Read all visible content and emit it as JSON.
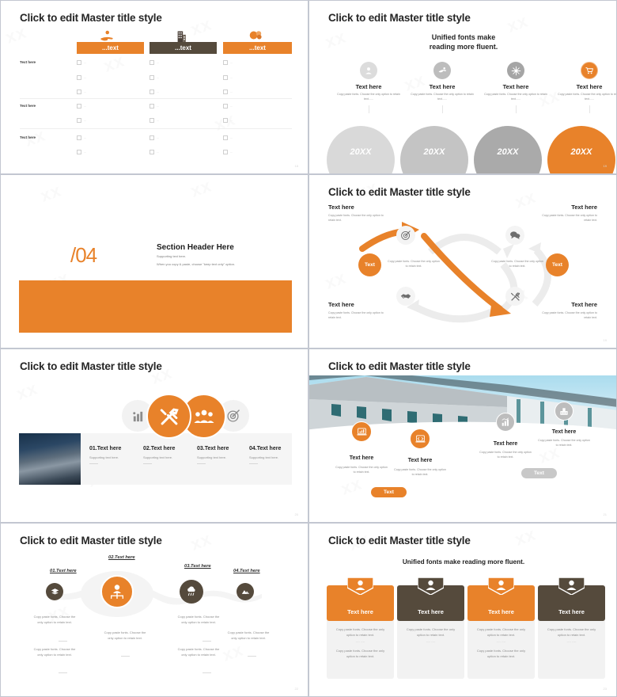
{
  "common": {
    "master_title": "Click to edit Master title style",
    "text_here": "Text here",
    "body_copy": "Copy paste fonts. Choose the only option to retain text.",
    "body_copy_ellipsis": "Copy paste fonts. Choose the only option to retain text......",
    "supporting": "Supporting text here.",
    "colors": {
      "orange": "#e8822a",
      "brown": "#554a3c",
      "gray": "#a8a8a8",
      "light_gray": "#d6d6d6",
      "sky": "#aadcee"
    }
  },
  "slides": [
    {
      "id": "slide-18-checklist-table",
      "page": "18",
      "title": "Click to edit Master title style",
      "columns": [
        {
          "label": "...text",
          "color": "#e8822a",
          "icon": "hand-coin-icon"
        },
        {
          "label": "...text",
          "color": "#554a3c",
          "icon": "building-icon"
        },
        {
          "label": "...text",
          "color": "#e8822a",
          "icon": "coins-icon"
        }
      ],
      "rows": [
        {
          "label": "Text here",
          "items": 3
        },
        {
          "label": "Text here",
          "items": 2
        },
        {
          "label": "Text here",
          "items": 2
        }
      ],
      "cell_text": "..."
    },
    {
      "id": "slide-19-timeline-arcs",
      "page": "19",
      "title": "Click to edit Master title style",
      "subtitle_line1": "Unified fonts make",
      "subtitle_line2": "reading more fluent.",
      "items": [
        {
          "heading": "Text here",
          "body": "Copy paste fonts. Choose the only option to retain text......",
          "icon": "person-icon",
          "icon_bg": "#dcdcdc",
          "year": "20XX",
          "arc_color": "#d9d9d9"
        },
        {
          "heading": "Text here",
          "body": "Copy paste fonts. Choose the only option to retain text......",
          "icon": "hand-icon",
          "icon_bg": "#bdbdbd",
          "year": "20XX",
          "arc_color": "#c4c4c4"
        },
        {
          "heading": "Text here",
          "body": "Copy paste fonts. Choose the only option to retain text......",
          "icon": "snowflake-icon",
          "icon_bg": "#a5a5a5",
          "year": "20XX",
          "arc_color": "#aaaaaa"
        },
        {
          "heading": "Text here",
          "body": "Copy paste fonts. Choose the only option to retain text......",
          "icon": "cart-icon",
          "icon_bg": "#e8822a",
          "year": "20XX",
          "arc_color": "#e8822a"
        }
      ]
    },
    {
      "id": "slide-section-header",
      "page": "",
      "number": "/04",
      "heading": "Section Header Here",
      "support1": "Supporting text here.",
      "support2": "When you copy & paste, choose \"keep text only\" option.",
      "band_color": "#e8822a"
    },
    {
      "id": "slide-19b-cycle-arrows",
      "page": "19",
      "title": "Click to edit Master title style",
      "corners": [
        {
          "heading": "Text here",
          "body": "Copy paste fonts. Choose the only option to retain text."
        },
        {
          "heading": "Text here",
          "body": "Copy paste fonts. Choose the only option to retain text."
        },
        {
          "heading": "Text here",
          "body": "Copy paste fonts. Choose the only option to retain text."
        },
        {
          "heading": "Text here",
          "body": "Copy paste fonts. Choose the only option to retain text."
        }
      ],
      "nodes": [
        {
          "icon": "target-icon"
        },
        {
          "icon": "speech-bubbles-icon"
        },
        {
          "icon": "handshake-icon"
        },
        {
          "icon": "tools-icon"
        }
      ],
      "bubbles": [
        {
          "label": "Text"
        },
        {
          "label": "Text"
        }
      ],
      "mid_bodies": [
        "Copy paste fonts. Choose the only option to retain text.",
        "Copy paste fonts. Choose the only option to retain text."
      ]
    },
    {
      "id": "slide-20-four-items",
      "page": "20",
      "title": "Click to edit Master title style",
      "icons": [
        {
          "icon": "chart-bars-icon",
          "bg": "#f2f2f2",
          "fg": "#8c8c8c",
          "size": "small"
        },
        {
          "icon": "tools-icon",
          "bg": "#e8822a",
          "fg": "#ffffff",
          "size": "large"
        },
        {
          "icon": "people-group-icon",
          "bg": "#e8822a",
          "fg": "#ffffff",
          "size": "large"
        },
        {
          "icon": "target-icon",
          "bg": "#f2f2f2",
          "fg": "#8c8c8c",
          "size": "small"
        }
      ],
      "cells": [
        {
          "heading": "01.Text here",
          "body": "Supporting text here."
        },
        {
          "heading": "02.Text here",
          "body": "Supporting text here."
        },
        {
          "heading": "03.Text here",
          "body": "Supporting text here."
        },
        {
          "heading": "04.Text here",
          "body": "Supporting text here."
        }
      ],
      "photo_alt": "mountain-photo"
    },
    {
      "id": "slide-21-building-photo",
      "page": "21",
      "title": "Click to edit Master title style",
      "photo_alt": "building-photo",
      "items": [
        {
          "heading": "Text here",
          "body": "Copy paste fonts. Choose the only option to retain text.",
          "icon": "laptop-chart-icon",
          "bg": "#e8822a"
        },
        {
          "heading": "Text here",
          "body": "Copy paste fonts. Choose the only option to retain text.",
          "icon": "laptop-code-icon",
          "bg": "#e8822a"
        },
        {
          "heading": "Text here",
          "body": "Copy paste fonts. Choose the only option to retain text.",
          "icon": "bar-chart-icon",
          "bg": "#bdbdbd"
        },
        {
          "heading": "Text here",
          "body": "Copy paste fonts. Choose the only option to retain text.",
          "icon": "factory-icon",
          "bg": "#bdbdbd"
        }
      ],
      "pills": [
        {
          "label": "Text",
          "bg": "#e8822a"
        },
        {
          "label": "Text",
          "bg": "#c8c8c8"
        }
      ]
    },
    {
      "id": "slide-22-chain",
      "page": "22",
      "title": "Click to edit Master title style",
      "nodes": [
        {
          "heading": "01.Text here",
          "icon": "layers-icon",
          "bg": "#554a3c",
          "size": 22,
          "bodies": [
            "Copy paste fonts. Choose the only option to retain text.",
            "Copy paste fonts. Choose the only option to retain text."
          ]
        },
        {
          "heading": "02.Text here",
          "icon": "person-network-icon",
          "bg": "#e8822a",
          "size": 42,
          "bodies": [
            "Copy paste fonts. Choose the only option to retain text."
          ]
        },
        {
          "heading": "03.Text here",
          "icon": "cloud-rain-icon",
          "bg": "#554a3c",
          "size": 30,
          "bodies": [
            "Copy paste fonts. Choose the only option to retain text.",
            "Copy paste fonts. Choose the only option to retain text."
          ]
        },
        {
          "heading": "04.Text here",
          "icon": "mountain-icon",
          "bg": "#554a3c",
          "size": 22,
          "bodies": [
            "Copy paste fonts. Choose the only option to retain text."
          ]
        }
      ]
    },
    {
      "id": "slide-23-cards",
      "page": "23",
      "title": "Click to edit Master title style",
      "subtitle": "Unified fonts make reading more fluent.",
      "cards": [
        {
          "heading": "Text here",
          "color": "#e8822a",
          "icon": "person-icon",
          "bodies": [
            "Copy paste fonts. Choose the only option to retain text.",
            "Copy paste fonts. Choose the only option to retain text."
          ],
          "divider": "---- ----"
        },
        {
          "heading": "Text here",
          "color": "#554a3c",
          "icon": "person-icon",
          "bodies": [
            "Copy paste fonts. Choose the only option to retain text."
          ],
          "divider": "---- ----"
        },
        {
          "heading": "Text here",
          "color": "#e8822a",
          "icon": "person-icon",
          "bodies": [
            "Copy paste fonts. Choose the only option to retain text.",
            "Copy paste fonts. Choose the only option to retain text."
          ],
          "divider": "---- ----"
        },
        {
          "heading": "Text here",
          "color": "#554a3c",
          "icon": "person-icon",
          "bodies": [
            "Copy paste fonts. Choose the only option to retain text."
          ],
          "divider": "---- ----"
        }
      ]
    }
  ]
}
